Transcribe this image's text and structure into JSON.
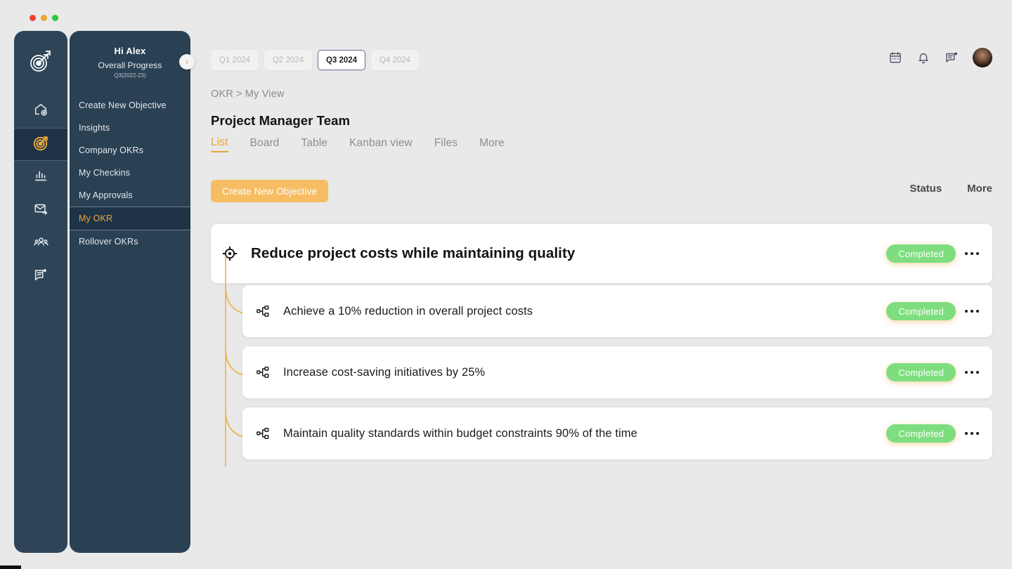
{
  "window": {
    "traffic_lights": [
      "close",
      "minimize",
      "maximize"
    ]
  },
  "rail": {
    "logo_icon": "target-arrow-logo-icon",
    "items": [
      {
        "icon": "home-add-icon",
        "name": "home",
        "active": false
      },
      {
        "icon": "target-icon",
        "name": "okr",
        "active": true
      },
      {
        "icon": "bar-chart-icon",
        "name": "analytics",
        "active": false
      },
      {
        "icon": "mail-send-icon",
        "name": "messages",
        "active": false
      },
      {
        "icon": "people-group-icon",
        "name": "team",
        "active": false
      },
      {
        "icon": "feedback-note-icon",
        "name": "feedback",
        "active": false
      }
    ]
  },
  "sidebar": {
    "greeting": "Hi Alex",
    "progress_label": "Overall Progress",
    "quarter_label": "Q3(2022-23)",
    "collapse_icon": "chevron-left-icon",
    "items": [
      {
        "label": "Create New Objective",
        "active": false
      },
      {
        "label": "Insights",
        "active": false
      },
      {
        "label": "Company OKRs",
        "active": false
      },
      {
        "label": "My  Checkins",
        "active": false
      },
      {
        "label": "My Approvals",
        "active": false
      },
      {
        "label": "My OKR",
        "active": true
      },
      {
        "label": "Rollover OKRs",
        "active": false
      }
    ]
  },
  "header": {
    "quarters": [
      {
        "label": "Q1 2024",
        "active": false
      },
      {
        "label": "Q2 2024",
        "active": false
      },
      {
        "label": "Q3 2024",
        "active": true
      },
      {
        "label": "Q4 2024",
        "active": false
      }
    ],
    "icons": [
      {
        "name": "calendar-icon"
      },
      {
        "name": "bell-icon"
      },
      {
        "name": "chat-notification-icon"
      }
    ],
    "avatar_name": "user-avatar"
  },
  "breadcrumb": {
    "root": "OKR",
    "separator": ">",
    "current": "My View"
  },
  "page": {
    "title": "Project Manager Team",
    "tabs": [
      {
        "label": "List",
        "active": true
      },
      {
        "label": "Board",
        "active": false
      },
      {
        "label": "Table",
        "active": false
      },
      {
        "label": "Kanban view",
        "active": false
      },
      {
        "label": "Files",
        "active": false
      },
      {
        "label": "More",
        "active": false
      }
    ]
  },
  "toolbar": {
    "create_objective_label": "Create New Objective",
    "col_status": "Status",
    "col_more": "More"
  },
  "objective": {
    "icon": "crosshair-target-icon",
    "title": "Reduce project costs while maintaining quality",
    "status": "Completed",
    "more_icon": "more-horizontal-icon",
    "key_results": [
      {
        "icon": "hierarchy-icon",
        "title": "Achieve a 10% reduction in overall project costs",
        "status": "Completed",
        "more_icon": "more-horizontal-icon"
      },
      {
        "icon": "hierarchy-icon",
        "title": "Increase cost-saving initiatives by 25%",
        "status": "Completed",
        "more_icon": "more-horizontal-icon"
      },
      {
        "icon": "hierarchy-icon",
        "title": "Maintain quality standards within budget constraints 90% of the time",
        "status": "Completed",
        "more_icon": "more-horizontal-icon"
      }
    ]
  },
  "colors": {
    "accent_orange": "#e8a33c",
    "cta_orange": "#f7bd63",
    "status_green": "#7ede7f",
    "sidebar_navy": "#2a4154",
    "rail_navy": "#2e4558",
    "page_bg": "#e9e9e9"
  }
}
